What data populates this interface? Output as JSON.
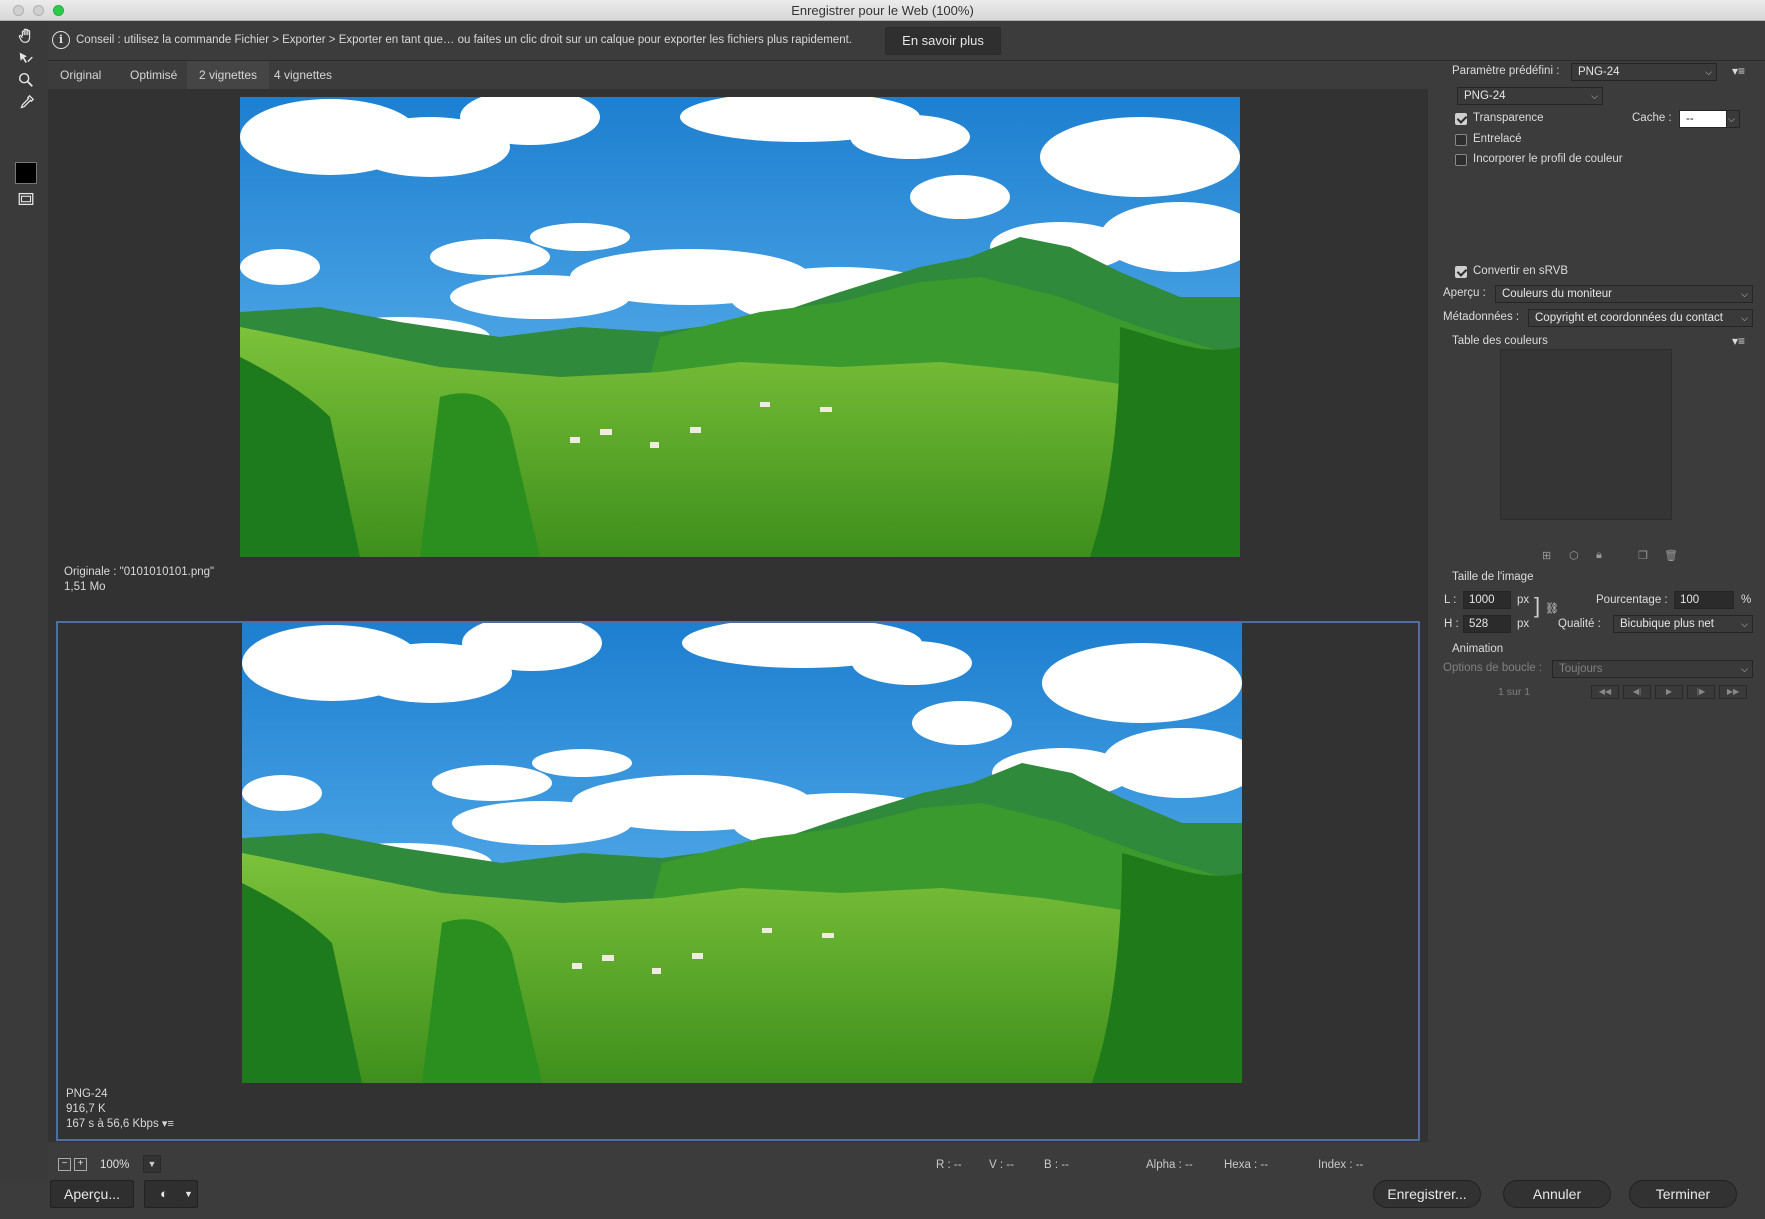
{
  "window": {
    "title": "Enregistrer pour le Web (100%)"
  },
  "tip": {
    "text": "Conseil : utilisez la commande Fichier > Exporter > Exporter en tant que… ou faites un clic droit sur un calque pour exporter les fichiers plus rapidement.",
    "button": "En savoir plus"
  },
  "tabs": [
    "Original",
    "Optimisé",
    "2 vignettes",
    "4 vignettes"
  ],
  "active_tab": "2 vignettes",
  "tools": [
    "hand-icon",
    "slice-select-icon",
    "zoom-icon",
    "eyedropper-icon",
    "color-swatch",
    "slice-visibility-icon"
  ],
  "colors": {
    "accent": "#4d6e9e",
    "swatch": "#000000"
  },
  "pane_original": {
    "line1": "Originale : \"0101010101.png\"",
    "line2": "1,51 Mo"
  },
  "pane_optimized": {
    "line1": "PNG-24",
    "line2": "916,7 K",
    "line3": "167 s à 56,6 Kbps"
  },
  "status": {
    "zoom": "100%",
    "r": "R : --",
    "v": "V : --",
    "b": "B : --",
    "alpha": "Alpha : --",
    "hexa": "Hexa : --",
    "index": "Index : --"
  },
  "buttons": {
    "preview": "Aperçu...",
    "save": "Enregistrer...",
    "cancel": "Annuler",
    "done": "Terminer"
  },
  "panel": {
    "preset_label": "Paramètre prédéfini :",
    "preset_value": "PNG-24",
    "format_value": "PNG-24",
    "transparency": "Transparence",
    "transparency_checked": true,
    "matte_label": "Cache :",
    "matte_value": "--",
    "interlaced": "Entrelacé",
    "interlaced_checked": false,
    "embed_profile": "Incorporer le profil de couleur",
    "embed_profile_checked": false,
    "convert_srgb": "Convertir en sRVB",
    "convert_srgb_checked": true,
    "preview_label": "Aperçu :",
    "preview_value": "Couleurs du moniteur",
    "metadata_label": "Métadonnées :",
    "metadata_value": "Copyright et coordonnées du contact",
    "color_table": "Table des couleurs",
    "image_size": "Taille de l'image",
    "w_label": "L :",
    "w_value": "1000",
    "h_label": "H :",
    "h_value": "528",
    "px": "px",
    "percent_label": "Pourcentage :",
    "percent_value": "100",
    "percent_unit": "%",
    "quality_label": "Qualité :",
    "quality_value": "Bicubique plus net",
    "animation": "Animation",
    "loop_label": "Options de boucle :",
    "loop_value": "Toujours",
    "frame_counter": "1 sur 1"
  }
}
